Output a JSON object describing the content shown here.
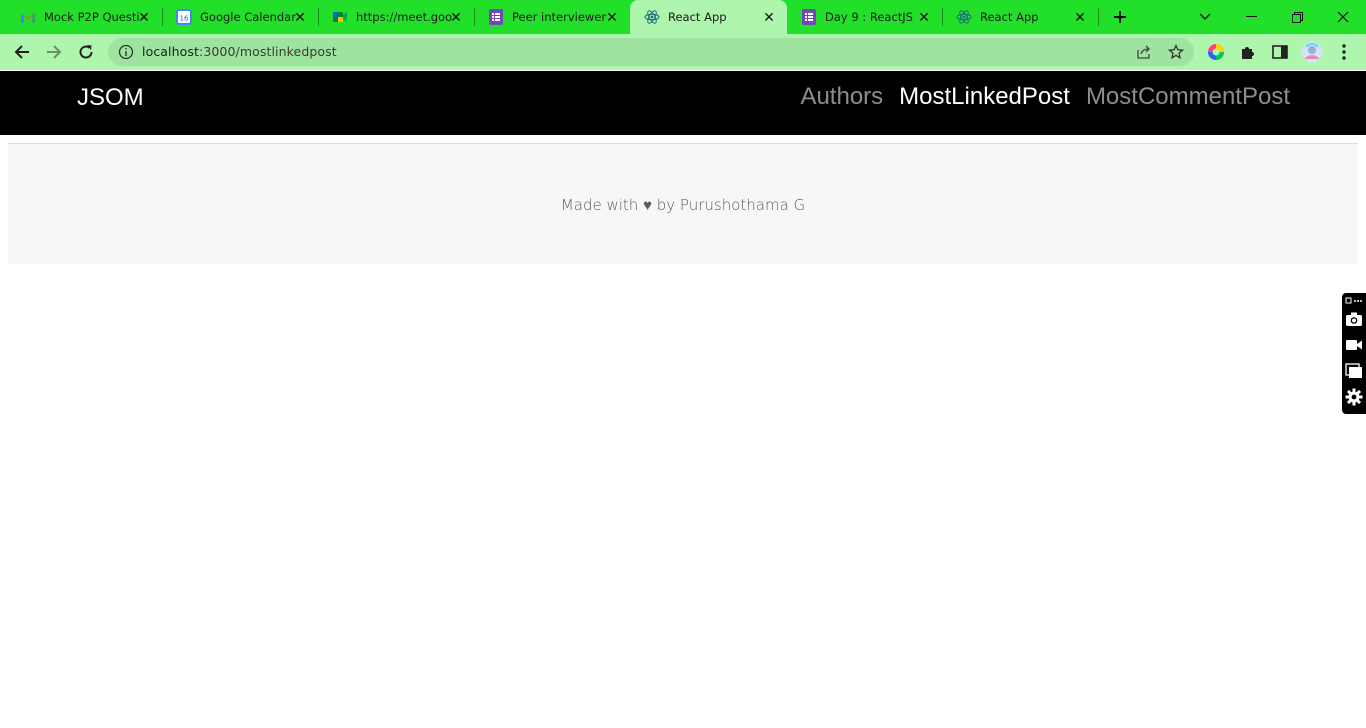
{
  "browser": {
    "tabs": [
      {
        "title": "Mock P2P Questi",
        "icon": "gmail-icon",
        "active": false
      },
      {
        "title": "Google Calendar",
        "icon": "calendar-icon",
        "active": false
      },
      {
        "title": "https://meet.goo",
        "icon": "meet-icon",
        "active": false
      },
      {
        "title": "Peer interviewer f",
        "icon": "forms-icon",
        "active": false
      },
      {
        "title": "React App",
        "icon": "react-icon",
        "active": true
      },
      {
        "title": "Day 9 : ReactJS",
        "icon": "forms-icon",
        "active": false
      },
      {
        "title": "React App",
        "icon": "react-icon",
        "active": false
      }
    ],
    "calendar_day": "16",
    "url": {
      "host": "localhost",
      "path": ":3000/mostlinkedpost"
    },
    "accent": "#22e029",
    "toolbar_color": "#aef5ae"
  },
  "page": {
    "brand": "JSOM",
    "nav": [
      {
        "label": "Authors",
        "active": false
      },
      {
        "label": "MostLinkedPost",
        "active": true
      },
      {
        "label": "MostCommentPost",
        "active": false
      }
    ],
    "footer": {
      "prefix": "Made with",
      "heart": "♥",
      "suffix": "by Purushothama G"
    }
  }
}
